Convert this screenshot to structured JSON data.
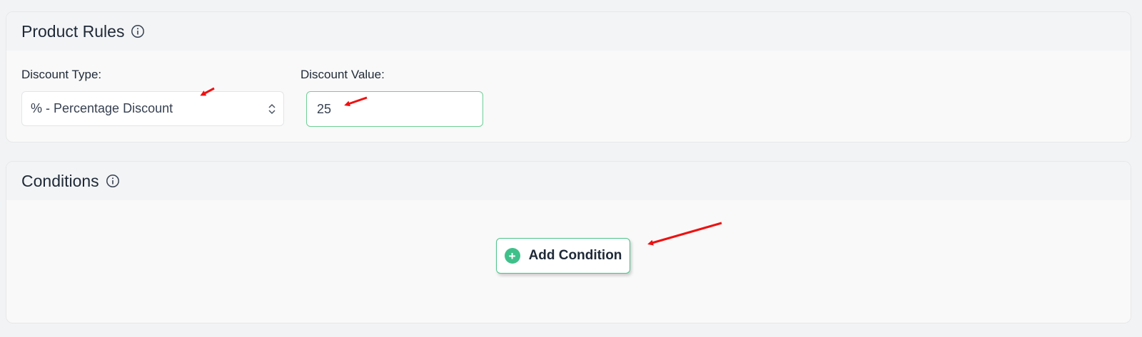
{
  "product_rules": {
    "title": "Product Rules",
    "discount_type": {
      "label": "Discount Type:",
      "selected": "% - Percentage Discount"
    },
    "discount_value": {
      "label": "Discount Value:",
      "value": "25"
    }
  },
  "conditions": {
    "title": "Conditions",
    "add_button_label": "Add Condition"
  },
  "icons": {
    "info": "info-circle-icon",
    "plus": "plus-circle-icon",
    "select": "chevron-up-down-icon"
  },
  "colors": {
    "accent_green": "#4cc38a",
    "annotation_red": "#ee1111"
  }
}
